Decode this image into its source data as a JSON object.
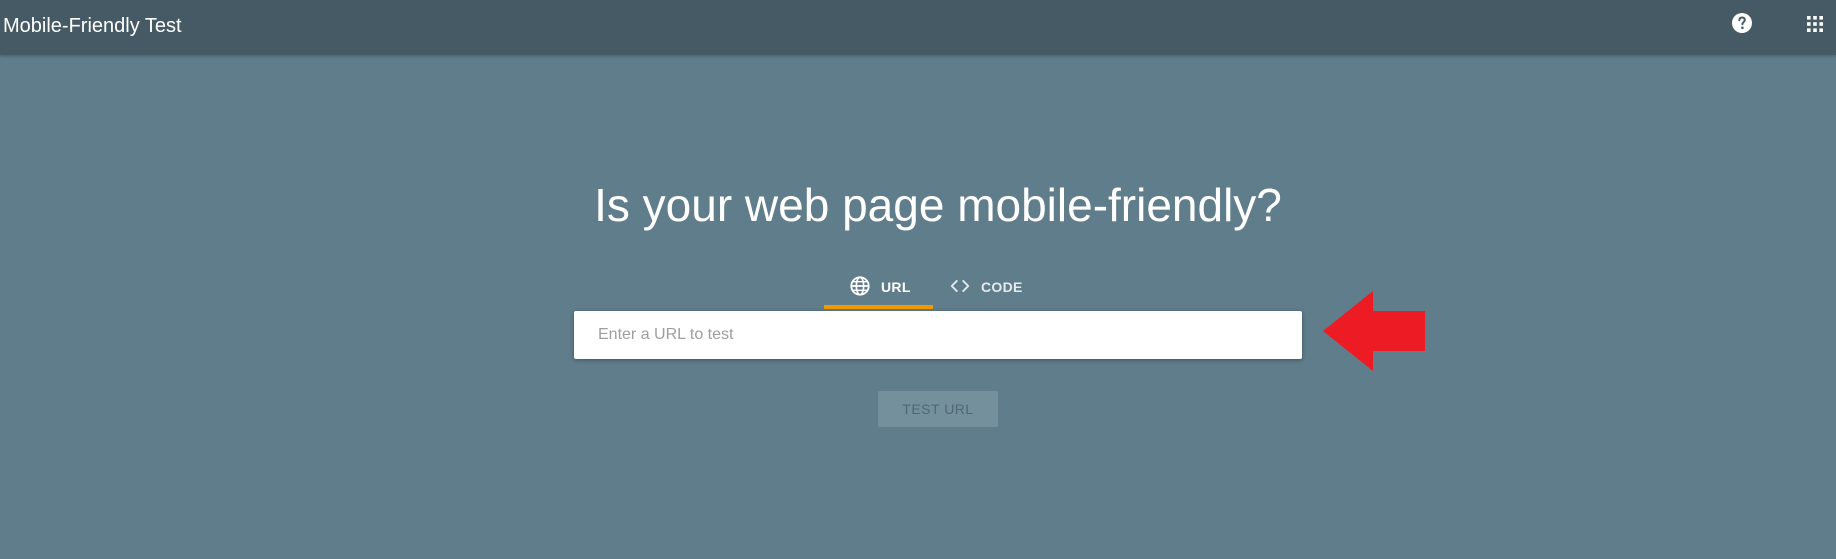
{
  "header": {
    "title": "Mobile-Friendly Test",
    "help_icon": "help-circle-icon",
    "apps_icon": "apps-grid-icon"
  },
  "main": {
    "headline": "Is your web page mobile-friendly?",
    "tabs": [
      {
        "label": "URL",
        "icon": "globe-icon",
        "active": true
      },
      {
        "label": "CODE",
        "icon": "code-brackets-icon",
        "active": false
      }
    ],
    "url_input": {
      "placeholder": "Enter a URL to test",
      "value": ""
    },
    "test_button_label": "TEST URL"
  },
  "colors": {
    "background": "#607d8b",
    "topbar": "#455a64",
    "active_tab_underline": "#f29900",
    "annotation_arrow": "#ed1c24"
  }
}
